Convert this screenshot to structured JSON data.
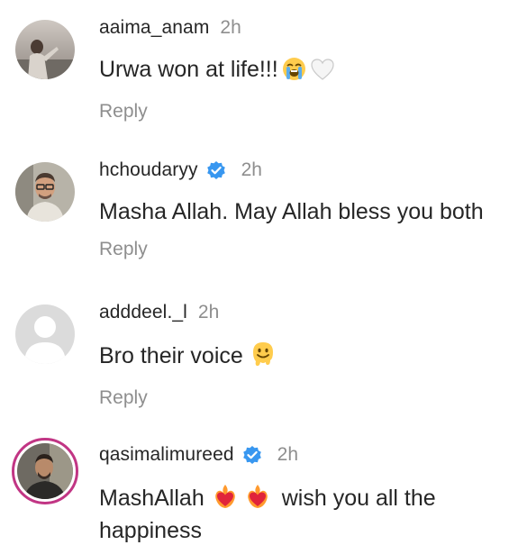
{
  "comments": [
    {
      "username": "aaima_anam",
      "time": "2h",
      "verified": false,
      "text": "Urwa won at life!!!",
      "emoji": [
        "loudly-crying-face",
        "white-heart"
      ],
      "reply_label": "Reply"
    },
    {
      "username": "hchoudaryy",
      "time": "2h",
      "verified": true,
      "text": "Masha Allah. May Allah bless you both",
      "emoji": [],
      "reply_label": "Reply"
    },
    {
      "username": "adddeel._l",
      "time": "2h",
      "verified": false,
      "text": "Bro their voice",
      "emoji": [
        "melting-face"
      ],
      "reply_label": "Reply"
    },
    {
      "username": "qasimalimureed",
      "time": "2h",
      "verified": true,
      "text_part1": "MashAllah",
      "text_part2": "wish you all the happiness",
      "emoji": [
        "heart-on-fire",
        "heart-on-fire"
      ],
      "story_ring": true
    }
  ],
  "colors": {
    "text": "#262626",
    "secondary": "#8e8e8e",
    "verified": "#3897f0",
    "story_ring": "#c13584"
  }
}
